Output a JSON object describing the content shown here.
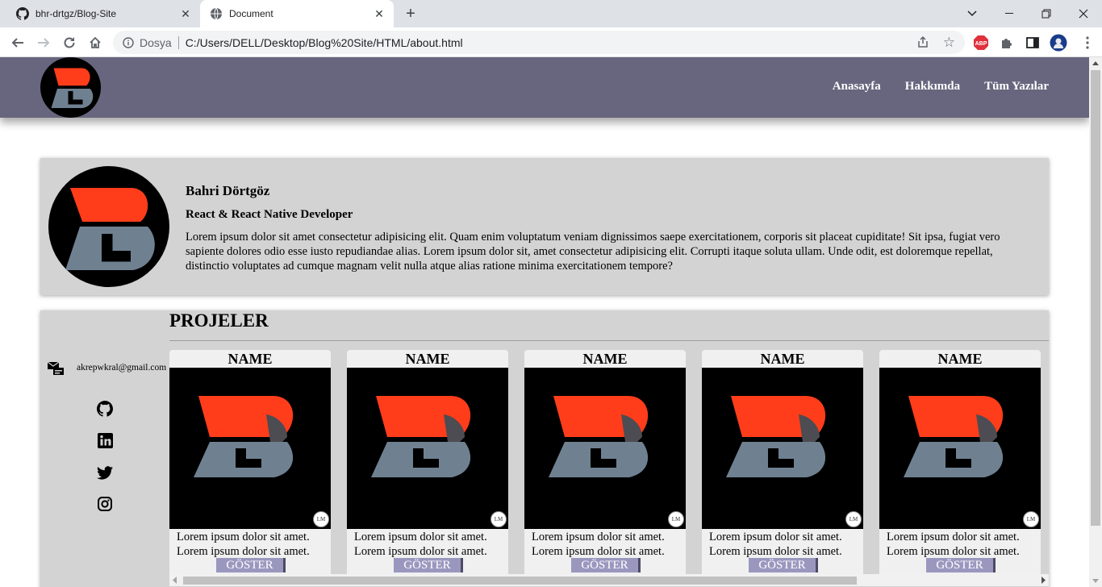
{
  "browser": {
    "tabs": [
      {
        "title": "bhr-drtgz/Blog-Site",
        "icon": "github-icon",
        "active": false
      },
      {
        "title": "Document",
        "icon": "globe-icon",
        "active": true
      }
    ],
    "omnibox": {
      "site_label": "Dosya",
      "url": "C:/Users/DELL/Desktop/Blog%20Site/HTML/about.html"
    },
    "extensions": [
      "abp-icon",
      "puzzle-icon",
      "sidepanel-icon",
      "profile-icon"
    ],
    "abp_label": "ABP"
  },
  "site": {
    "nav": [
      "Anasayfa",
      "Hakkımda",
      "Tüm Yazılar"
    ],
    "colors": {
      "header": "#68657e",
      "logo_orange": "#ff3d1a",
      "logo_steel": "#6f8191",
      "card": "#d3d3d3",
      "button": "#9a97bf"
    }
  },
  "about": {
    "name": "Bahri Dörtgöz",
    "role": "React & React Native Developer",
    "bio": "Lorem ipsum dolor sit amet consectetur adipisicing elit. Quam enim voluptatum veniam dignissimos saepe exercitationem, corporis sit placeat cupiditate! Sit ipsa, fugiat vero sapiente dolores odio esse iusto repudiandae alias. Lorem ipsum dolor sit, amet consectetur adipisicing elit. Corrupti itaque soluta ullam. Unde odit, est doloremque repellat, distinctio voluptates ad cumque magnam velit nulla atque alias ratione minima exercitationem tempore?"
  },
  "contact": {
    "email": "akrepwkral@gmail.com",
    "social": [
      "github-icon",
      "linkedin-icon",
      "twitter-icon",
      "instagram-icon"
    ]
  },
  "projects": {
    "title": "PROJELER",
    "items": [
      {
        "name": "NAME",
        "desc": "Lorem ipsum dolor sit amet. Lorem ipsum dolor sit amet.",
        "button": "GÖSTER",
        "badge": "LM"
      },
      {
        "name": "NAME",
        "desc": "Lorem ipsum dolor sit amet. Lorem ipsum dolor sit amet.",
        "button": "GÖSTER",
        "badge": "LM"
      },
      {
        "name": "NAME",
        "desc": "Lorem ipsum dolor sit amet. Lorem ipsum dolor sit amet.",
        "button": "GÖSTER",
        "badge": "LM"
      },
      {
        "name": "NAME",
        "desc": "Lorem ipsum dolor sit amet. Lorem ipsum dolor sit amet.",
        "button": "GÖSTER",
        "badge": "LM"
      },
      {
        "name": "NAME",
        "desc": "Lorem ipsum dolor sit amet. Lorem ipsum dolor sit amet.",
        "button": "GÖSTER",
        "badge": "LM"
      }
    ]
  }
}
